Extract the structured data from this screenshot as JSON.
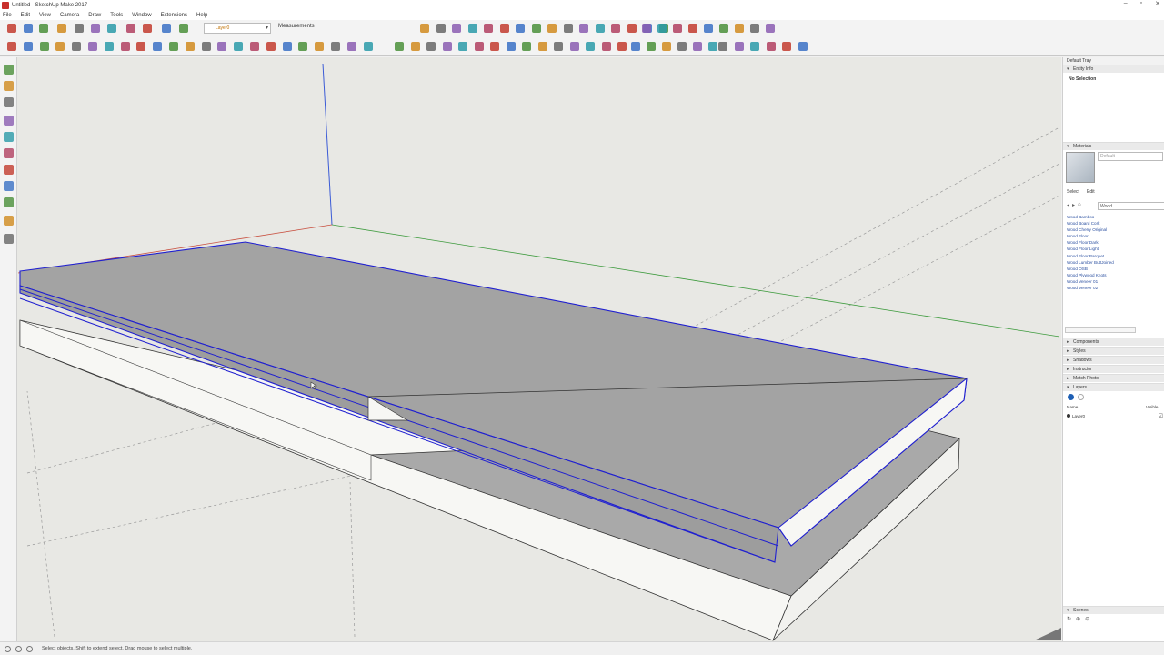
{
  "window": {
    "title": "Untitled - SketchUp Make 2017"
  },
  "menu": [
    "File",
    "Edit",
    "View",
    "Camera",
    "Draw",
    "Tools",
    "Window",
    "Extensions",
    "Help"
  ],
  "toolbar": {
    "layer_value": "Layer0",
    "measurements_label": "Measurements"
  },
  "tray": {
    "title": "Default Tray",
    "entity_info": {
      "header": "Entity Info",
      "selection": "No Selection"
    },
    "materials": {
      "header": "Materials",
      "current": "Default",
      "tabs": [
        "Select",
        "Edit"
      ],
      "search_value": "Wood",
      "items": [
        "Wood Bamboo",
        "Wood Board Cork",
        "Wood Cherry Original",
        "Wood Floor",
        "Wood Floor Dark",
        "Wood Floor Light",
        "Wood Floor Parquet",
        "Wood Lumber ButtJoined",
        "Wood OSB",
        "Wood Plywood Knots",
        "Wood Veneer 01",
        "Wood Veneer 02"
      ]
    },
    "panels": [
      "Components",
      "Styles",
      "Shadows",
      "Instructor",
      "Match Photo",
      "Layers"
    ],
    "layers": {
      "col_name": "Name",
      "col_visible": "Visible",
      "rows": [
        {
          "name": "Layer0"
        }
      ]
    },
    "scenes": {
      "header": "Scenes"
    }
  },
  "status": {
    "text": "Select objects. Shift to extend select. Drag mouse to select multiple."
  },
  "colors": {
    "selection": "#2020d0",
    "face_top": "#a3a3a3",
    "face_side": "#f7f7f4",
    "background": "#e8e8e4",
    "axis_green": "#3c9a3c",
    "axis_blue": "#3b5bd6",
    "axis_red": "#c85040"
  }
}
